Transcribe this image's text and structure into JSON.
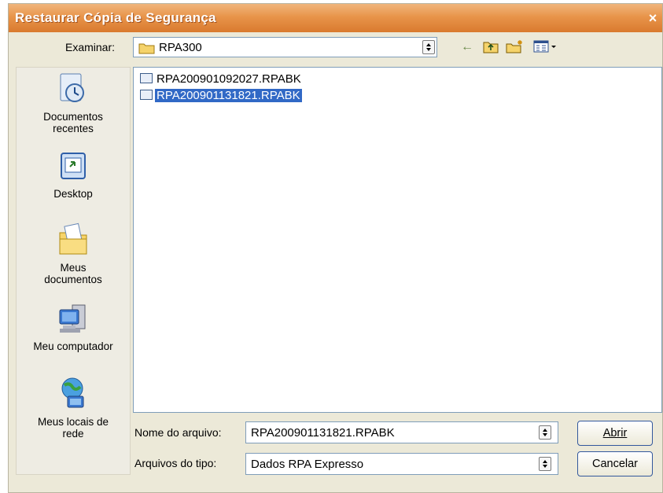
{
  "window": {
    "title": "Restaurar Cópia de Segurança",
    "close_glyph": "×"
  },
  "lookin": {
    "label": "Examinar:",
    "folder": "RPA300",
    "folder_icon": "folder-icon"
  },
  "toolbar": {
    "back_icon": "back-arrow-icon",
    "back_glyph": "←",
    "up_icon": "up-folder-icon",
    "new_folder_icon": "new-folder-icon",
    "views_icon": "views-menu-icon"
  },
  "places": [
    {
      "label_line1": "Documentos",
      "label_line2": "recentes",
      "icon": "recent-documents-icon"
    },
    {
      "label_line1": "Desktop",
      "label_line2": "",
      "icon": "desktop-icon"
    },
    {
      "label_line1": "Meus",
      "label_line2": "documentos",
      "icon": "my-documents-icon"
    },
    {
      "label_line1": "Meu computador",
      "label_line2": "",
      "icon": "my-computer-icon"
    },
    {
      "label_line1": "Meus locais de",
      "label_line2": "rede",
      "icon": "network-places-icon"
    }
  ],
  "files": [
    {
      "name": "RPA200901092027.RPABK",
      "selected": false
    },
    {
      "name": "RPA200901131821.RPABK",
      "selected": true
    }
  ],
  "filename": {
    "label": "Nome do arquivo:",
    "value": "RPA200901131821.RPABK"
  },
  "filetype": {
    "label": "Arquivos do tipo:",
    "value": "Dados RPA Expresso"
  },
  "buttons": {
    "open": "Abrir",
    "cancel": "Cancelar"
  },
  "colors": {
    "titlebar": "#e8944a",
    "selection": "#3169c6",
    "dialog_bg": "#ece9d8"
  }
}
